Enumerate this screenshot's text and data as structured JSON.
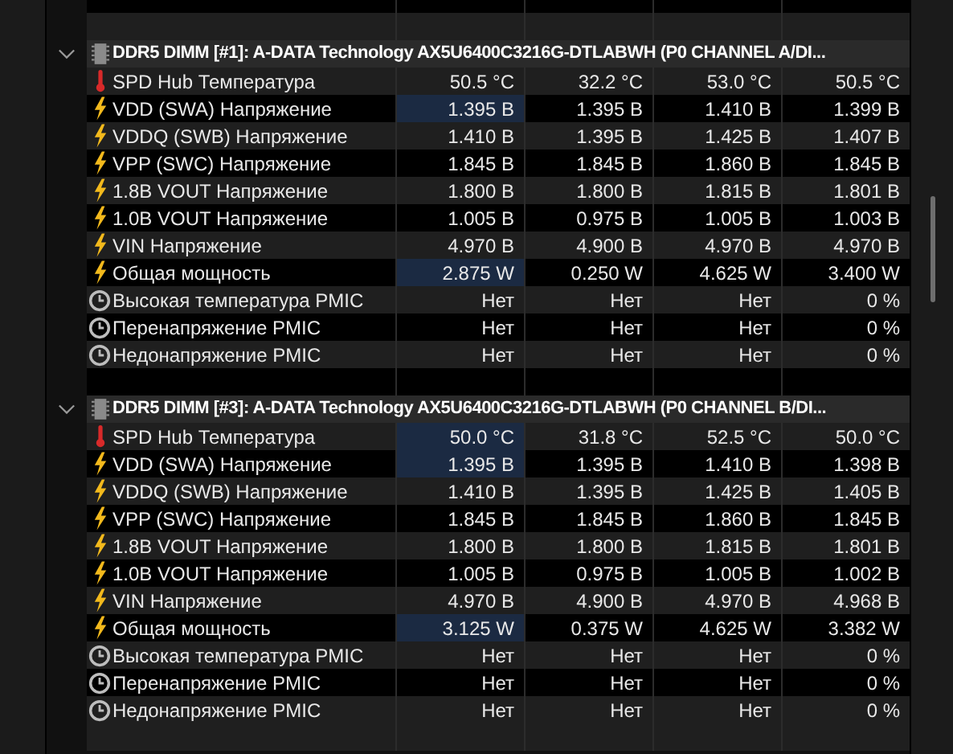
{
  "groups": [
    {
      "title": "DDR5 DIMM [#1]: A-DATA Technology AX5U6400C3216G-DTLABWH (P0 CHANNEL A/DI...",
      "expanded": true,
      "rows": [
        {
          "kind": "temperature",
          "label": "SPD Hub Температура",
          "values": [
            "50.5 °C",
            "32.2 °C",
            "53.0 °C",
            "50.5 °C"
          ],
          "highlighted": false
        },
        {
          "kind": "voltage",
          "label": "VDD (SWA) Напряжение",
          "values": [
            "1.395 B",
            "1.395 B",
            "1.410 B",
            "1.399 B"
          ],
          "highlighted": true
        },
        {
          "kind": "voltage",
          "label": "VDDQ (SWB) Напряжение",
          "values": [
            "1.410 B",
            "1.395 B",
            "1.425 B",
            "1.407 B"
          ],
          "highlighted": false
        },
        {
          "kind": "voltage",
          "label": "VPP (SWC) Напряжение",
          "values": [
            "1.845 B",
            "1.845 B",
            "1.860 B",
            "1.845 B"
          ],
          "highlighted": false
        },
        {
          "kind": "voltage",
          "label": "1.8B VOUT Напряжение",
          "values": [
            "1.800 B",
            "1.800 B",
            "1.815 B",
            "1.801 B"
          ],
          "highlighted": false
        },
        {
          "kind": "voltage",
          "label": "1.0B VOUT Напряжение",
          "values": [
            "1.005 B",
            "0.975 B",
            "1.005 B",
            "1.003 B"
          ],
          "highlighted": false
        },
        {
          "kind": "voltage",
          "label": "VIN Напряжение",
          "values": [
            "4.970 B",
            "4.900 B",
            "4.970 B",
            "4.970 B"
          ],
          "highlighted": false
        },
        {
          "kind": "voltage",
          "label": "Общая мощность",
          "values": [
            "2.875 W",
            "0.250 W",
            "4.625 W",
            "3.400 W"
          ],
          "highlighted": true
        },
        {
          "kind": "flag",
          "label": "Высокая температура PMIC",
          "values": [
            "Нет",
            "Нет",
            "Нет",
            "0 %"
          ],
          "highlighted": false
        },
        {
          "kind": "flag",
          "label": "Перенапряжение PMIC",
          "values": [
            "Нет",
            "Нет",
            "Нет",
            "0 %"
          ],
          "highlighted": false
        },
        {
          "kind": "flag",
          "label": "Недонапряжение PMIC",
          "values": [
            "Нет",
            "Нет",
            "Нет",
            "0 %"
          ],
          "highlighted": false
        }
      ]
    },
    {
      "title": "DDR5 DIMM [#3]: A-DATA Technology AX5U6400C3216G-DTLABWH (P0 CHANNEL B/DI...",
      "expanded": true,
      "rows": [
        {
          "kind": "temperature",
          "label": "SPD Hub Температура",
          "values": [
            "50.0 °C",
            "31.8 °C",
            "52.5 °C",
            "50.0 °C"
          ],
          "highlighted": true
        },
        {
          "kind": "voltage",
          "label": "VDD (SWA) Напряжение",
          "values": [
            "1.395 B",
            "1.395 B",
            "1.410 B",
            "1.398 B"
          ],
          "highlighted": true
        },
        {
          "kind": "voltage",
          "label": "VDDQ (SWB) Напряжение",
          "values": [
            "1.410 B",
            "1.395 B",
            "1.425 B",
            "1.405 B"
          ],
          "highlighted": false
        },
        {
          "kind": "voltage",
          "label": "VPP (SWC) Напряжение",
          "values": [
            "1.845 B",
            "1.845 B",
            "1.860 B",
            "1.845 B"
          ],
          "highlighted": false
        },
        {
          "kind": "voltage",
          "label": "1.8B VOUT Напряжение",
          "values": [
            "1.800 B",
            "1.800 B",
            "1.815 B",
            "1.801 B"
          ],
          "highlighted": false
        },
        {
          "kind": "voltage",
          "label": "1.0B VOUT Напряжение",
          "values": [
            "1.005 B",
            "0.975 B",
            "1.005 B",
            "1.002 B"
          ],
          "highlighted": false
        },
        {
          "kind": "voltage",
          "label": "VIN Напряжение",
          "values": [
            "4.970 B",
            "4.900 B",
            "4.970 B",
            "4.968 B"
          ],
          "highlighted": false
        },
        {
          "kind": "voltage",
          "label": "Общая мощность",
          "values": [
            "3.125 W",
            "0.375 W",
            "4.625 W",
            "3.382 W"
          ],
          "highlighted": true
        },
        {
          "kind": "flag",
          "label": "Высокая температура PMIC",
          "values": [
            "Нет",
            "Нет",
            "Нет",
            "0 %"
          ],
          "highlighted": false
        },
        {
          "kind": "flag",
          "label": "Перенапряжение PMIC",
          "values": [
            "Нет",
            "Нет",
            "Нет",
            "0 %"
          ],
          "highlighted": false
        },
        {
          "kind": "flag",
          "label": "Недонапряжение PMIC",
          "values": [
            "Нет",
            "Нет",
            "Нет",
            "0 %"
          ],
          "highlighted": false
        }
      ]
    }
  ]
}
